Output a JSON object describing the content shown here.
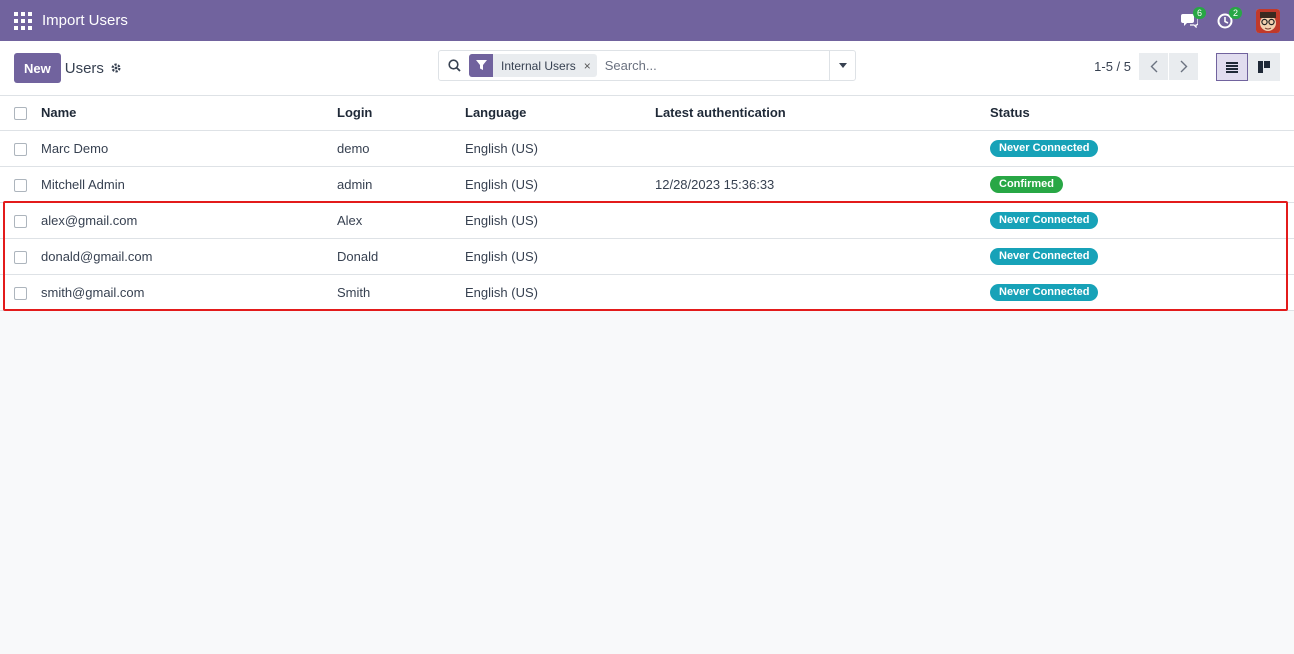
{
  "navbar": {
    "title": "Import Users",
    "messages_count": "6",
    "activities_count": "2"
  },
  "control": {
    "new_label": "New",
    "breadcrumb": "Users",
    "facet_label": "Internal Users",
    "facet_close": "×",
    "search_placeholder": "Search...",
    "pager": "1-5 / 5"
  },
  "table": {
    "headers": [
      "Name",
      "Login",
      "Language",
      "Latest authentication",
      "Status"
    ],
    "rows": [
      {
        "name": "Marc Demo",
        "login": "demo",
        "language": "English (US)",
        "latest_auth": "",
        "status": "Never Connected"
      },
      {
        "name": "Mitchell Admin",
        "login": "admin",
        "language": "English (US)",
        "latest_auth": "12/28/2023 15:36:33",
        "status": "Confirmed"
      },
      {
        "name": "alex@gmail.com",
        "login": "Alex",
        "language": "English (US)",
        "latest_auth": "",
        "status": "Never Connected"
      },
      {
        "name": "donald@gmail.com",
        "login": "Donald",
        "language": "English (US)",
        "latest_auth": "",
        "status": "Never Connected"
      },
      {
        "name": "smith@gmail.com",
        "login": "Smith",
        "language": "English (US)",
        "latest_auth": "",
        "status": "Never Connected"
      }
    ]
  },
  "colors": {
    "brand": "#71639e",
    "never_connected": "#17a2b8",
    "confirmed": "#28a745",
    "highlight": "#e31b1b"
  },
  "icons": [
    "apps-grid-icon",
    "chat-icon",
    "clock-icon",
    "user-avatar",
    "gear-icon",
    "search-icon",
    "filter-icon",
    "chevron-left-icon",
    "chevron-right-icon",
    "list-view-icon",
    "kanban-view-icon"
  ]
}
